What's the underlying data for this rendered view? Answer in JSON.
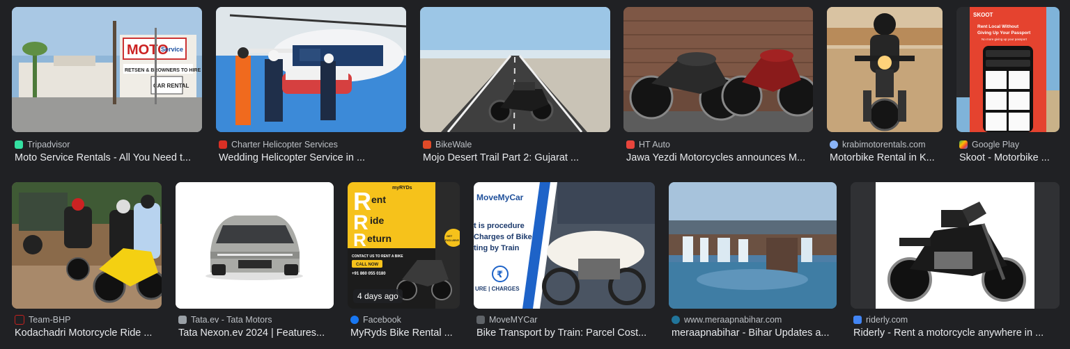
{
  "results": [
    {
      "source": "Tripadvisor",
      "title": "Moto Service Rentals - All You Need t...",
      "fav_color": "#34e0a1",
      "fav_icon": "tripadvisor-icon"
    },
    {
      "source": "Charter Helicopter Services",
      "title": "Wedding Helicopter Service in ...",
      "fav_color": "#d93025",
      "fav_icon": "helicopter-icon"
    },
    {
      "source": "BikeWale",
      "title": "Mojo Desert Trail Part 2: Gujarat ...",
      "fav_color": "#e04a28",
      "fav_icon": "bikewale-icon"
    },
    {
      "source": "HT Auto",
      "title": "Jawa Yezdi Motorcycles announces M...",
      "fav_color": "#e8453c",
      "fav_icon": "htauto-icon"
    },
    {
      "source": "krabimotorentals.com",
      "title": "Motorbike Rental in K...",
      "fav_color": "#8ab4f8",
      "fav_icon": "globe-icon"
    },
    {
      "source": "Google Play",
      "title": "Skoot - Motorbike ...",
      "fav_color": "#34a853",
      "fav_icon": "google-play-icon"
    },
    {
      "source": "Team-BHP",
      "title": "Kodachadri Motorcycle Ride ...",
      "fav_color": "#c5221f",
      "fav_icon": "teambhp-icon"
    },
    {
      "source": "Tata.ev - Tata Motors",
      "title": "Tata Nexon.ev 2024 | Features...",
      "fav_color": "#9aa0a6",
      "fav_icon": "tata-icon"
    },
    {
      "source": "Facebook",
      "title": "MyRyds Bike Rental ...",
      "fav_color": "#1877f2",
      "fav_icon": "facebook-icon",
      "badge": "4 days ago"
    },
    {
      "source": "MoveMYCar",
      "title": "Bike Transport by Train: Parcel Cost...",
      "fav_color": "#5f6368",
      "fav_icon": "movemycar-icon"
    },
    {
      "source": "www.meraapnabihar.com",
      "title": "meraapnabihar - Bihar Updates a...",
      "fav_color": "#21759b",
      "fav_icon": "wordpress-icon"
    },
    {
      "source": "riderly.com",
      "title": "Riderly - Rent a motorcycle anywhere in ...",
      "fav_color": "#4285f4",
      "fav_icon": "riderly-icon"
    }
  ],
  "thumb_text": {
    "moto_sign": "MOTO",
    "moto_service": "Service",
    "moto_banner": "RETSEN & BROWNERS TO HIRE",
    "car_rental": "CAR RENTAL",
    "skoot_brand": "SKOOT",
    "skoot_headline": "Rent Local Without Giving Up Your Passport",
    "skoot_sub": "No more giving up your passport",
    "myryds_r1": "R",
    "myryds_w1": "ent",
    "myryds_r2": "R",
    "myryds_w2": "ide",
    "myryds_r3": "R",
    "myryds_w3": "eturn",
    "myryds_contact": "CONTACT US TO RENT A BIKE",
    "myryds_call": "CALL NOW",
    "myryds_phone": "+91 860 055 0180",
    "myryds_logo": "myRYDs",
    "myryds_offer": "GET EXCLUSIVE DISCOUNT",
    "mmc_logo": "MoveMyCar",
    "mmc_line1": "t is procedure",
    "mmc_line2": "Charges of Bike",
    "mmc_line3": "ting by Train",
    "mmc_bottom": "URE | CHARGES",
    "mmc_symbol": "₹"
  }
}
